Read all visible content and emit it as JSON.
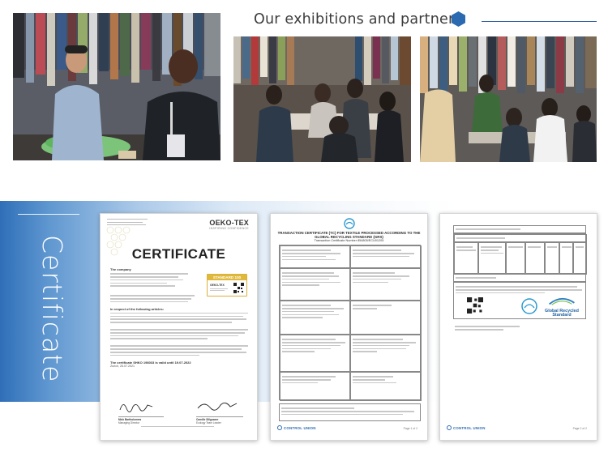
{
  "exhibitions": {
    "title": "Our exhibitions and partners",
    "accent": "#2b6ab0",
    "photos": [
      {
        "name": "exhibition-photo-1"
      },
      {
        "name": "exhibition-photo-2"
      },
      {
        "name": "exhibition-photo-3"
      }
    ]
  },
  "certificates": {
    "label": "Certificate",
    "band_colors": [
      "#2f6fb8",
      "#ffffff"
    ],
    "oeko": {
      "brand": "OEKO-TEX",
      "brand_tag": "INSPIRING CONFIDENCE",
      "title": "CERTIFICATE",
      "badge_top": "OEKO-TEX",
      "badge_std": "STANDARD 100",
      "company_label": "The company",
      "following_label": "In respect of the following articles:",
      "valid_line": "The certificate SHKO 198033 is valid until 19.07.2022",
      "place_date": "Zurich, 26.07.2021",
      "signer_1": "Mick Bartholomew",
      "signer_1_role": "Managing Director",
      "signer_2": "Camille Sillguaser",
      "signer_2_role": "Ecology Team Leader"
    },
    "grs1": {
      "head_1": "TRANSACTION CERTIFICATE (TC) FOR TEXTILE PROCESSED ACCORDING TO THE",
      "head_2": "GLOBAL RECYCLING STANDARD (GRS)",
      "head_3": "Transaction Certificate Number 854805/ECU01205",
      "footer": "CONTROL UNION",
      "page": "Page 1 of 2"
    },
    "grs2": {
      "recycled_logo": "Global Recycled Standard",
      "footer": "CONTROL UNION",
      "page": "Page 2 of 2"
    }
  }
}
